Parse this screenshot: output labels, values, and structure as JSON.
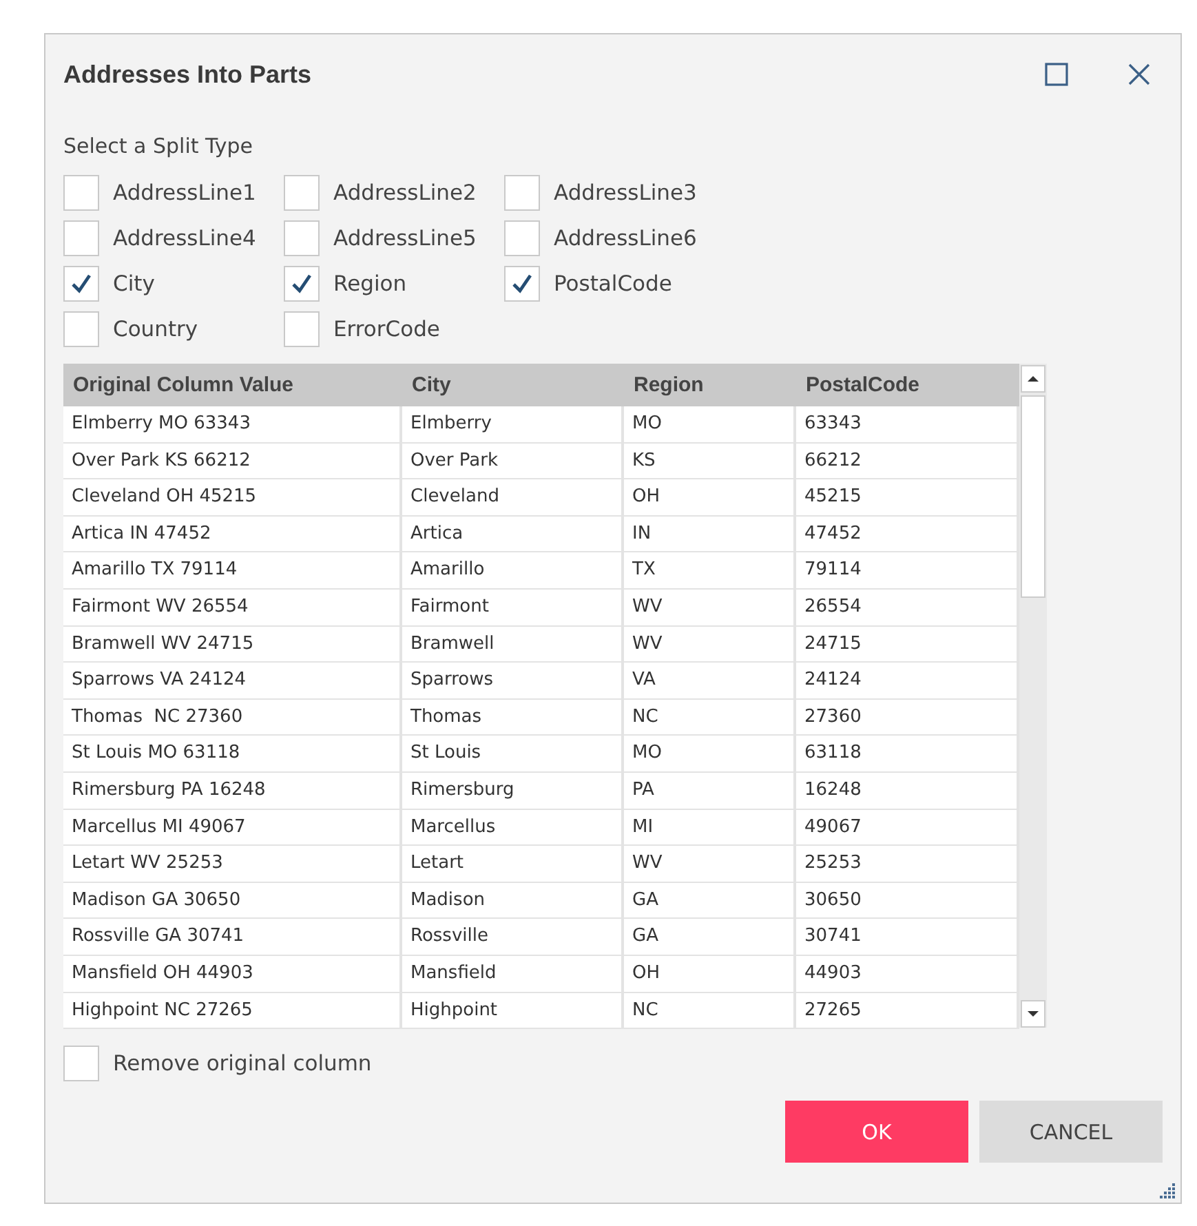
{
  "window": {
    "title": "Addresses Into Parts"
  },
  "split_type": {
    "label": "Select a Split Type",
    "options": [
      {
        "label": "AddressLine1",
        "checked": false
      },
      {
        "label": "AddressLine2",
        "checked": false
      },
      {
        "label": "AddressLine3",
        "checked": false
      },
      {
        "label": "AddressLine4",
        "checked": false
      },
      {
        "label": "AddressLine5",
        "checked": false
      },
      {
        "label": "AddressLine6",
        "checked": false
      },
      {
        "label": "City",
        "checked": true
      },
      {
        "label": "Region",
        "checked": true
      },
      {
        "label": "PostalCode",
        "checked": true
      },
      {
        "label": "Country",
        "checked": false
      },
      {
        "label": "ErrorCode",
        "checked": false
      }
    ]
  },
  "table": {
    "columns": [
      "Original Column Value",
      "City",
      "Region",
      "PostalCode"
    ],
    "rows": [
      [
        "Elmberry MO 63343",
        "Elmberry",
        "MO",
        "63343"
      ],
      [
        "Over Park KS 66212",
        "Over Park",
        "KS",
        "66212"
      ],
      [
        "Cleveland OH 45215",
        "Cleveland",
        "OH",
        "45215"
      ],
      [
        "Artica IN 47452",
        "Artica",
        "IN",
        "47452"
      ],
      [
        "Amarillo TX 79114",
        "Amarillo",
        "TX",
        "79114"
      ],
      [
        "Fairmont WV 26554",
        "Fairmont",
        "WV",
        "26554"
      ],
      [
        "Bramwell WV 24715",
        "Bramwell",
        "WV",
        "24715"
      ],
      [
        "Sparrows VA 24124",
        "Sparrows",
        "VA",
        "24124"
      ],
      [
        "Thomas  NC 27360",
        "Thomas",
        "NC",
        "27360"
      ],
      [
        "St Louis MO 63118",
        "St Louis",
        "MO",
        "63118"
      ],
      [
        "Rimersburg PA 16248",
        "Rimersburg",
        "PA",
        "16248"
      ],
      [
        "Marcellus MI 49067",
        "Marcellus",
        "MI",
        "49067"
      ],
      [
        "Letart WV 25253",
        "Letart",
        "WV",
        "25253"
      ],
      [
        "Madison GA 30650",
        "Madison",
        "GA",
        "30650"
      ],
      [
        "Rossville GA 30741",
        "Rossville",
        "GA",
        "30741"
      ],
      [
        "Mansfield OH 44903",
        "Mansfield",
        "OH",
        "44903"
      ],
      [
        "Highpoint NC 27265",
        "Highpoint",
        "NC",
        "27265"
      ]
    ]
  },
  "remove_original": {
    "label": "Remove original column",
    "checked": false
  },
  "buttons": [
    {
      "label": "OK",
      "kind": "primary"
    },
    {
      "label": "CANCEL",
      "kind": "secondary"
    }
  ]
}
